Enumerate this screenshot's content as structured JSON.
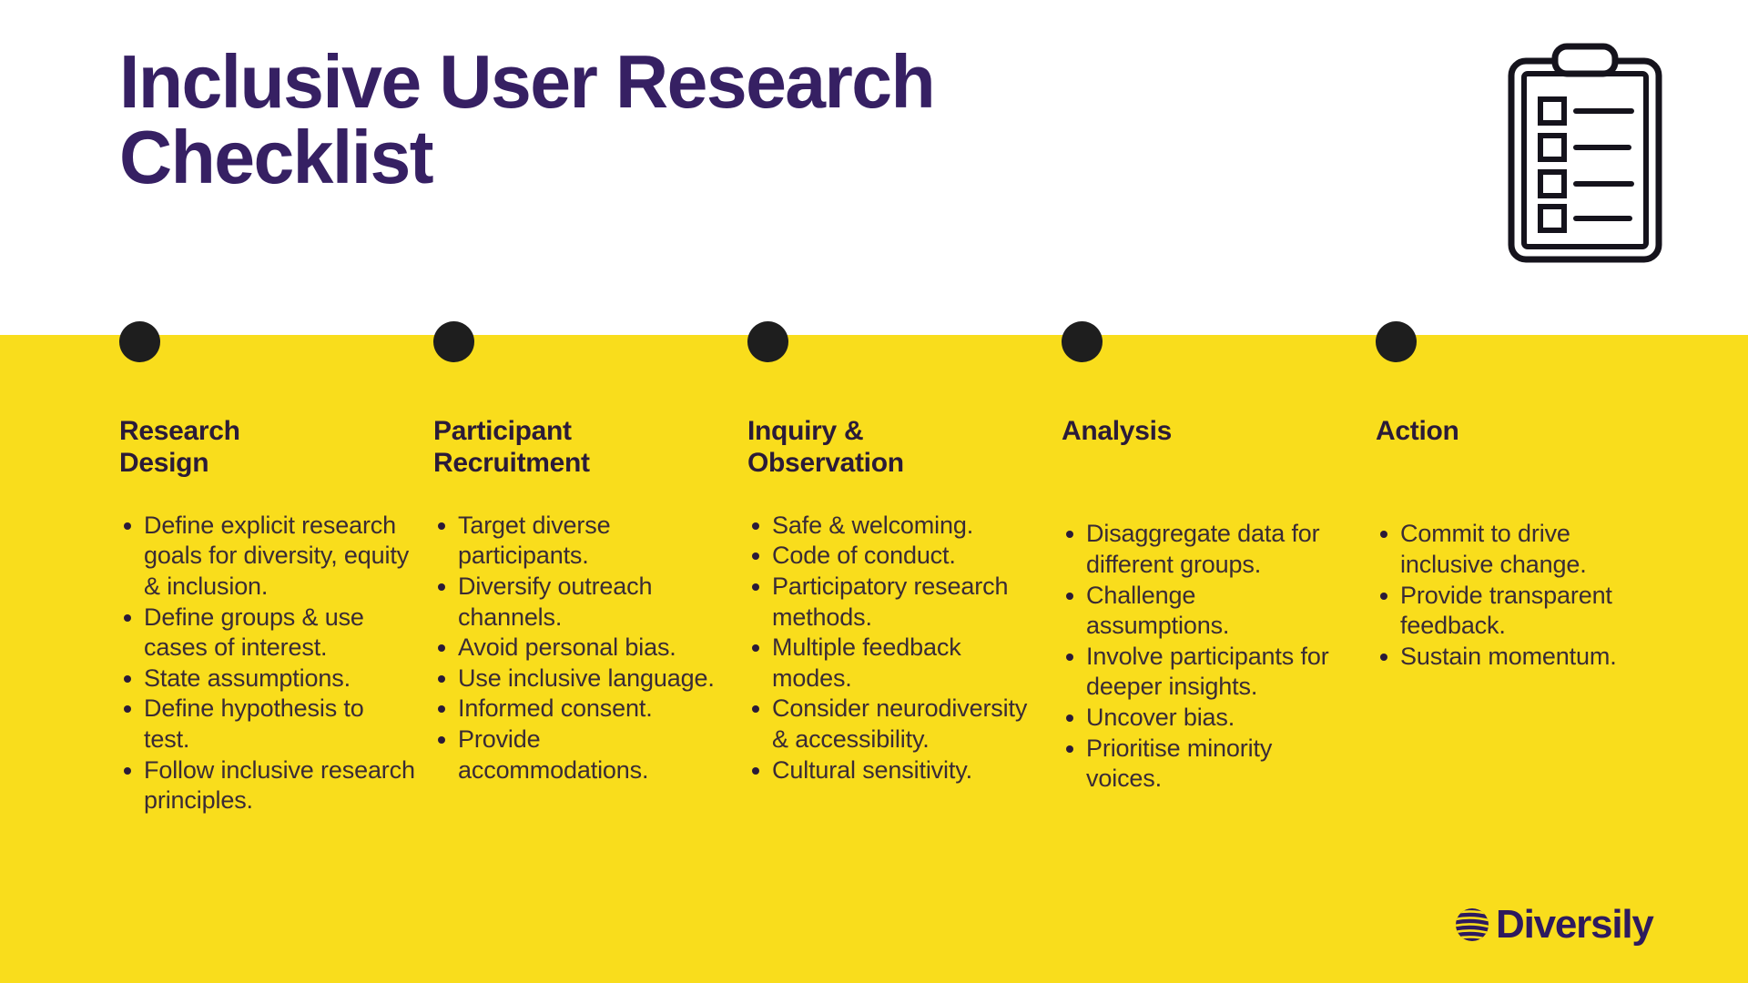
{
  "header": {
    "title": "Inclusive User Research\nChecklist",
    "title_color": "#362063",
    "icon": "clipboard-checklist-icon"
  },
  "theme": {
    "background": "#FFFFFF",
    "band_color": "#F9DD1C",
    "dot_color": "#1E1E1E",
    "heading_color": "#2B1B38",
    "body_color": "#3A2B35",
    "logo_color": "#2E1A5E"
  },
  "columns": [
    {
      "heading": "Research\nDesign",
      "items": [
        "Define explicit research goals for diversity, equity & inclusion.",
        "Define groups & use cases of interest.",
        "State assumptions.",
        "Define hypothesis to test.",
        "Follow inclusive research principles."
      ]
    },
    {
      "heading": "Participant\nRecruitment",
      "items": [
        "Target diverse participants.",
        "Diversify outreach channels.",
        "Avoid personal bias.",
        "Use inclusive language.",
        "Informed consent.",
        "Provide accommodations."
      ]
    },
    {
      "heading": "Inquiry &\nObservation",
      "items": [
        "Safe & welcoming.",
        "Code of conduct.",
        "Participatory research methods.",
        "Multiple feedback modes.",
        "Consider neurodiversity & accessibility.",
        "Cultural sensitivity."
      ]
    },
    {
      "heading": "Analysis",
      "items": [
        "Disaggregate data for different groups.",
        "Challenge assumptions.",
        "Involve participants for deeper insights.",
        "Uncover bias.",
        "Prioritise minority voices."
      ]
    },
    {
      "heading": "Action",
      "items": [
        "Commit to drive inclusive change.",
        "Provide transparent feedback.",
        "Sustain momentum."
      ]
    }
  ],
  "logo": {
    "name": "Diversily",
    "mark": "striped-globe-icon"
  }
}
